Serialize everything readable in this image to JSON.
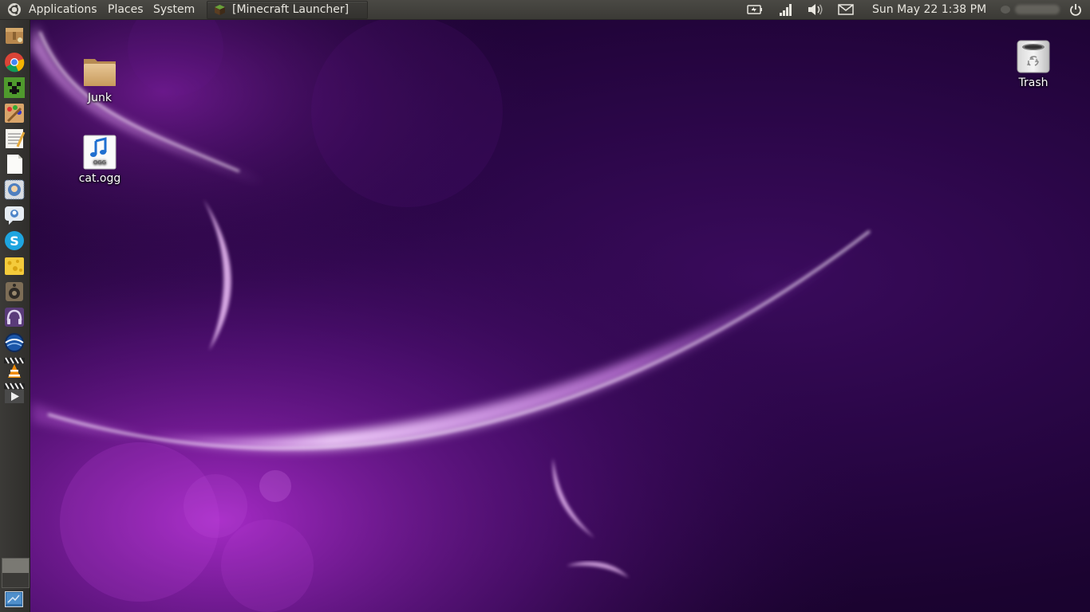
{
  "top_panel": {
    "menus": [
      "Applications",
      "Places",
      "System"
    ],
    "taskbar_window": "[Minecraft Launcher]",
    "clock": "Sun May 22  1:38 PM",
    "indicators": [
      "battery-icon",
      "network-icon",
      "volume-icon",
      "mail-icon",
      "user-status-icon",
      "power-icon"
    ]
  },
  "launcher": {
    "icons": [
      "archive-manager-icon",
      "chrome-icon",
      "minecraft-icon",
      "paint-icon",
      "text-editor-icon",
      "document-icon",
      "mail-client-icon",
      "chat-icon",
      "skype-icon",
      "cheese-icon",
      "speaker-icon",
      "headphones-icon",
      "globe-icon",
      "vlc-icon",
      "video-player-icon"
    ]
  },
  "desktop": {
    "icons": [
      {
        "name": "Junk",
        "icon": "folder-icon"
      },
      {
        "name": "cat.ogg",
        "icon": "audio-file-icon",
        "badge": "OGG"
      },
      {
        "name": "Trash",
        "icon": "trash-icon"
      }
    ]
  },
  "colors": {
    "panel": "#3c3b37",
    "wallpaper_dark": "#1b0330",
    "wallpaper_glow": "#c23ee0"
  }
}
